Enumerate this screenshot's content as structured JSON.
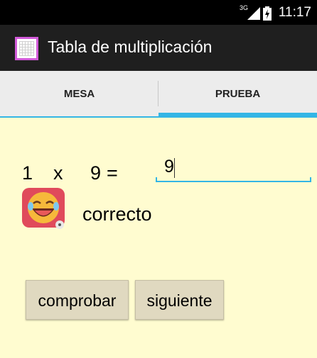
{
  "status_bar": {
    "network": "3G",
    "time": "11:17"
  },
  "action_bar": {
    "title": "Tabla de multiplicación",
    "icon": "grid-app-icon"
  },
  "tabs": [
    {
      "label": "MESA",
      "selected": false
    },
    {
      "label": "PRUEBA",
      "selected": true
    }
  ],
  "problem": {
    "a": "1",
    "times": "x",
    "b": "9",
    "equals": "=",
    "answer": "9"
  },
  "feedback": {
    "icon": "laughing-face-icon",
    "text": "correcto"
  },
  "buttons": {
    "check": "comprobar",
    "next": "siguiente"
  },
  "colors": {
    "accent": "#33b5e5",
    "background": "#fffcd0",
    "button": "#e0d9c0",
    "actionbar": "#1f1f1f",
    "app_icon_border": "#d25ad9"
  }
}
